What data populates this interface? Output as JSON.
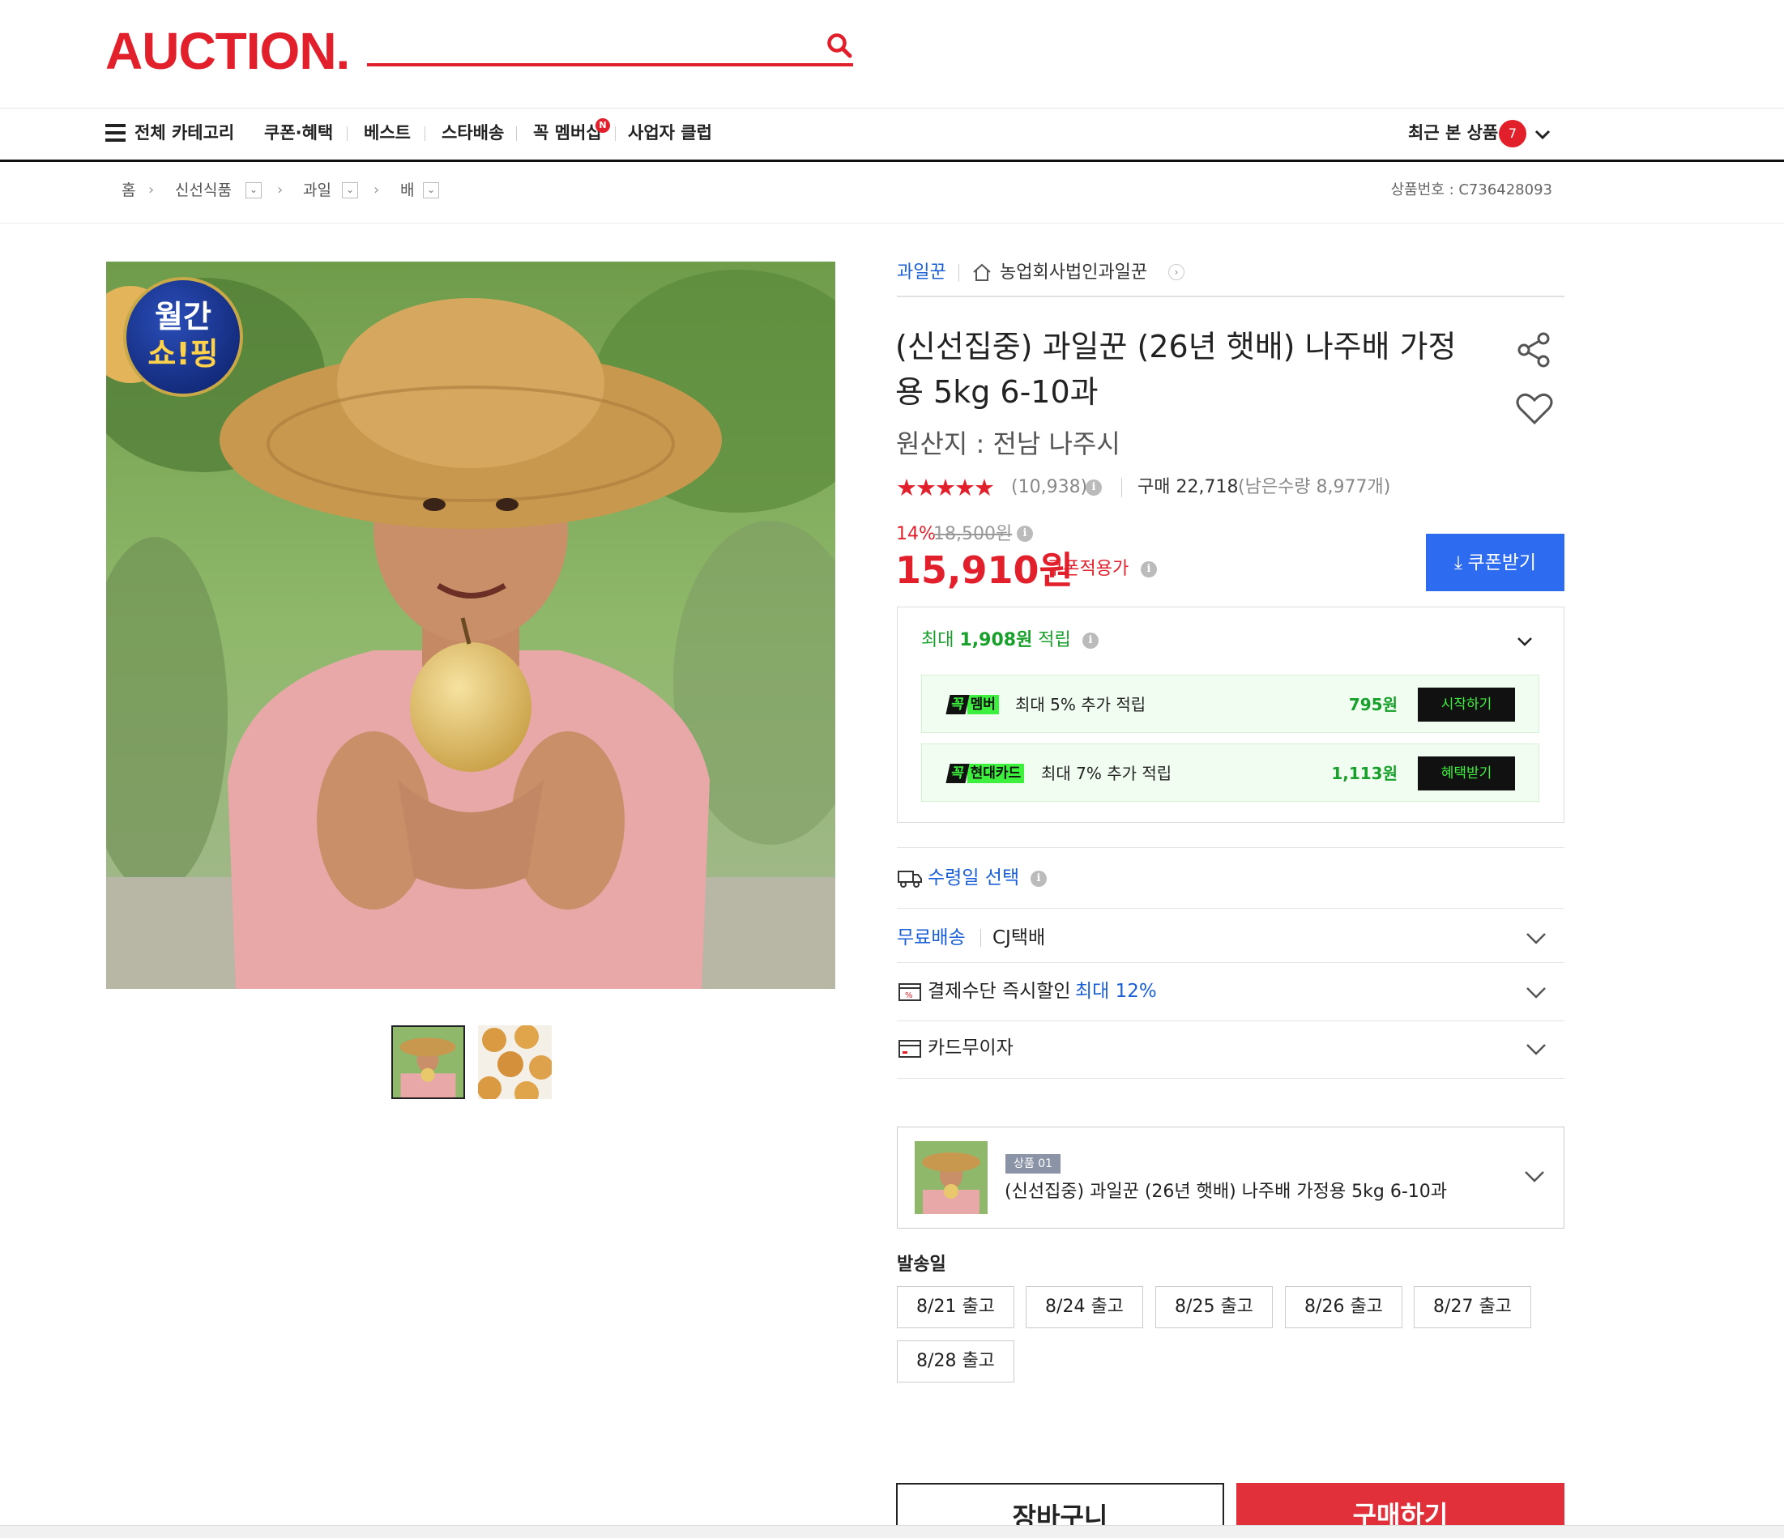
{
  "header": {
    "logo": "AUCTION.",
    "nav": {
      "all_categories": "전체 카테고리",
      "items": [
        "쿠폰·혜택",
        "베스트",
        "스타배송",
        "꼭 멤버십",
        "사업자 클럽"
      ],
      "membership_badge": "N",
      "recent_label": "최근 본 상품",
      "recent_count": "7"
    }
  },
  "breadcrumb": {
    "home": "홈",
    "items": [
      "신선식품",
      "과일",
      "배"
    ],
    "product_no": "상품번호 : C736428093"
  },
  "gallery": {
    "badge_line1": "월간",
    "badge_line2": "쇼!핑"
  },
  "product": {
    "seller_short": "과일꾼",
    "seller_full": "농업회사법인과일꾼",
    "title": "(신선집중) 과일꾼 (26년 햇배) 나주배 가정용 5kg 6-10과",
    "origin": "원산지 : 전남 나주시",
    "rating": 4.7,
    "stars": "★★★★★",
    "review_count": "(10,938)",
    "purchase": "구매 22,718",
    "remaining": "(남은수량 8,977개)",
    "discount_rate": "14%",
    "original_price": "18,500원",
    "sale_price": "15,910원",
    "coupon_price_label": "쿠폰적용가",
    "coupon_button": "⤓ 쿠폰받기"
  },
  "points": {
    "label_prefix": "최대 ",
    "label_amount": "1,908원",
    "label_suffix": " 적립",
    "benefits": [
      {
        "k": "꼭",
        "name": "멤버",
        "text": "최대 5% 추가 적립",
        "amount": "795원",
        "button": "시작하기"
      },
      {
        "k": "꼭",
        "name": "현대카드",
        "text": "최대 7% 추가 적립",
        "amount": "1,113원",
        "button": "혜택받기"
      }
    ]
  },
  "delivery": {
    "receive_date": "수령일 선택",
    "free_shipping": "무료배송",
    "carrier": "CJ택배",
    "payment_discount": "결제수단 즉시할인",
    "payment_rate": "최대 12%",
    "card_installment": "카드무이자"
  },
  "option": {
    "tag": "상품 01",
    "name": "(신선집중) 과일꾼 (26년 햇배) 나주배 가정용 5kg 6-10과"
  },
  "shipping_dates": {
    "label": "발송일",
    "dates": [
      "8/21 출고",
      "8/24 출고",
      "8/25 출고",
      "8/26 출고",
      "8/27 출고",
      "8/28 출고"
    ]
  },
  "actions": {
    "cart": "장바구니",
    "buy": "구매하기"
  },
  "colors": {
    "brand": "#e2202c",
    "link_blue": "#1a5fd8",
    "coupon_blue": "#2d6bf0",
    "points_green": "#17a02a"
  }
}
